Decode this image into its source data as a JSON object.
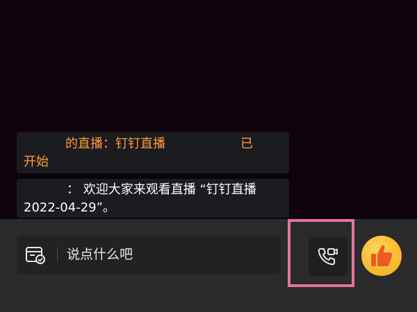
{
  "comments": [
    {
      "line1_prefix": "的直播：",
      "line1_title": "钉钉直播",
      "line1_suffix": "已",
      "line2": "开始"
    },
    {
      "line1": "：  欢迎大家来观看直播 “钉钉直播",
      "line2": "2022-04-29”。"
    }
  ],
  "input": {
    "placeholder": "说点什么吧",
    "icon": "comment-box-icon"
  },
  "buttons": {
    "call_icon": "phone-video-icon",
    "like_icon": "thumbs-up-icon"
  },
  "colors": {
    "highlight_orange": "#ff9c3b",
    "call_button_border": "#e8739a",
    "like_button": "#f7b52a"
  }
}
